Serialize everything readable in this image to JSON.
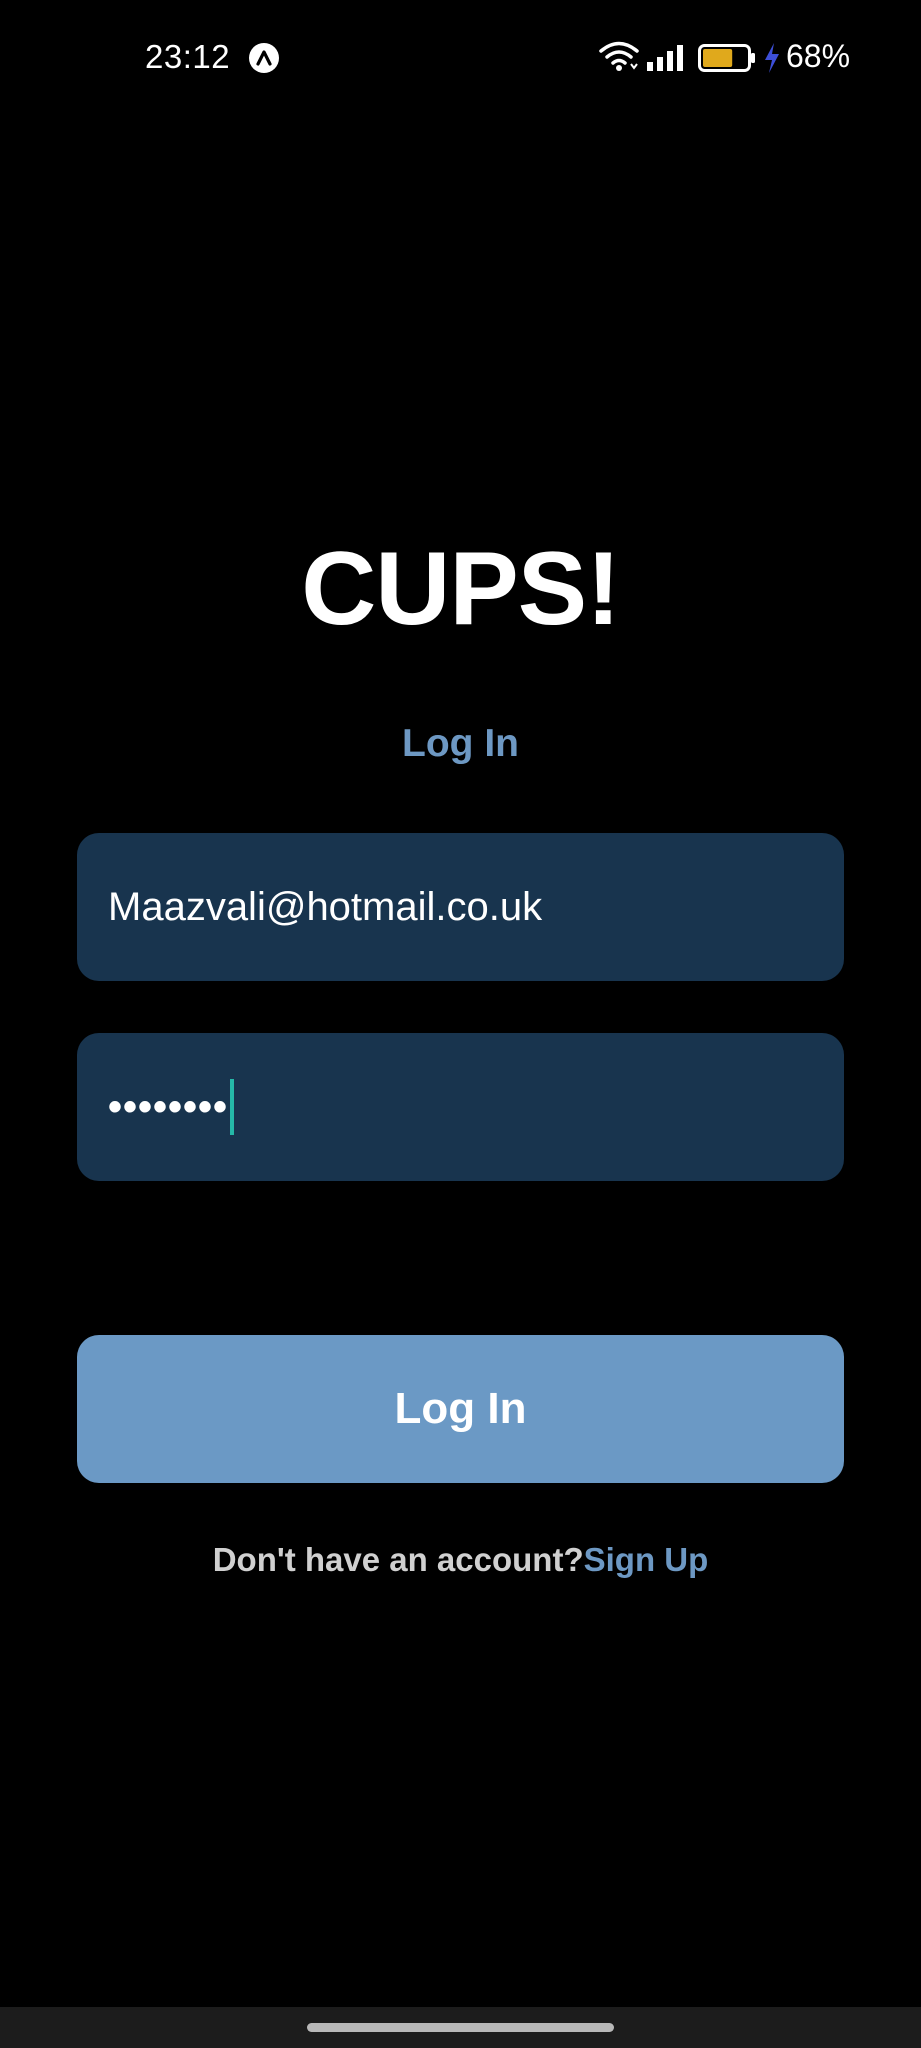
{
  "status_bar": {
    "time": "23:12",
    "battery_percent": "68%",
    "battery_level": 0.68,
    "battery_color": "#e0a91c",
    "charging_color": "#3d4fd8"
  },
  "app": {
    "title": "CUPS!",
    "subtitle": "Log In"
  },
  "form": {
    "email_value": "Maazvali@hotmail.co.uk",
    "password_mask": "••••••••",
    "login_button_label": "Log In"
  },
  "footer": {
    "prompt": "Don't have an account?",
    "signup_link": "Sign Up"
  },
  "colors": {
    "background": "#000000",
    "accent": "#6d98c3",
    "field_bg": "#18344e",
    "button_bg": "#6b99c5",
    "caret": "#25b8a8"
  }
}
